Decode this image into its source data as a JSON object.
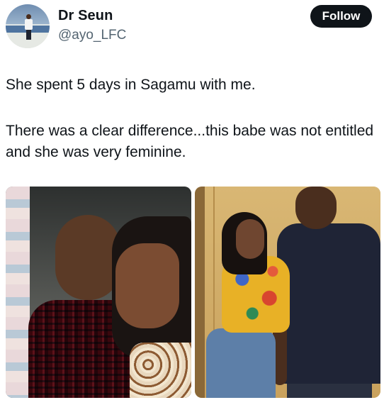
{
  "user": {
    "display_name": "Dr Seun",
    "handle": "@ayo_LFC"
  },
  "follow_button": {
    "label": "Follow",
    "color": "#0f1419"
  },
  "tweet": {
    "line1": "She spent 5 days in Sagamu with me.",
    "paragraph2": "There was a clear difference...this babe was not entitled and she was very feminine."
  },
  "colors": {
    "name_text": "#0f1419",
    "handle_text": "#536471"
  }
}
